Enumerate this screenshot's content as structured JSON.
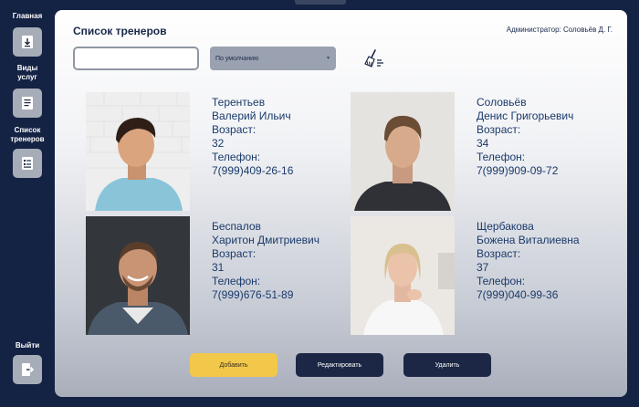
{
  "sidebar": {
    "items": [
      {
        "label": "Главная",
        "icon": "download-icon"
      },
      {
        "label": "Виды услуг",
        "icon": "document-icon"
      },
      {
        "label": "Список тренеров",
        "icon": "list-icon"
      }
    ],
    "logout_label": "Выйти",
    "logout_icon": "logout-icon"
  },
  "header": {
    "title": "Список тренеров",
    "admin": "Администратор: Соловьёв Д. Г."
  },
  "filters": {
    "search_value": "",
    "search_placeholder": "",
    "sort_value": "По умолчанию",
    "clear_icon": "broom-icon"
  },
  "trainers": [
    {
      "last_name": "Терентьев",
      "name": "Валерий  Ильич",
      "age_label": "Возраст:",
      "age": "32",
      "phone_label": "Телефон:",
      "phone": "7(999)409-26-16"
    },
    {
      "last_name": "Соловьёв",
      "name": "Денис  Григорьевич",
      "age_label": "Возраст:",
      "age": "34",
      "phone_label": "Телефон:",
      "phone": "7(999)909-09-72"
    },
    {
      "last_name": "Беспалов",
      "name": "Харитон  Дмитриевич",
      "age_label": "Возраст:",
      "age": "31",
      "phone_label": "Телефон:",
      "phone": "7(999)676-51-89"
    },
    {
      "last_name": "Щербакова",
      "name": "Божена  Виталиевна",
      "age_label": "Возраст:",
      "age": "37",
      "phone_label": "Телефон:",
      "phone": "7(999)040-99-36"
    }
  ],
  "actions": {
    "add": "Добавить",
    "edit": "Редактировать",
    "delete": "Удалить"
  },
  "colors": {
    "background": "#142243",
    "accent_yellow": "#f2c84b",
    "dark_button": "#1b2745",
    "text_blue": "#1a3a6a"
  }
}
